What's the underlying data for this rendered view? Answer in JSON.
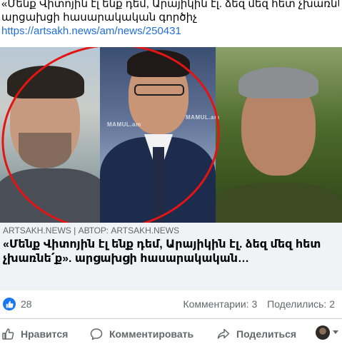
{
  "post": {
    "text_line1": "«Մենք Վիտոյին էլ ենք դեմ, Արայիկին էլ. ձեզ մեզ հետ չխառնե՛ք».",
    "text_line2": "արցախցի հասարակական գործիչ",
    "link": "https://artsakh.news/am/news/250431"
  },
  "link_card": {
    "watermark": "MAMUL.am",
    "info_icon": "info-icon",
    "domain": "ARTSAKH.NEWS | АВТОР: ARTSAKH.NEWS",
    "title": "«Մենք Վիտոյին էլ ենք դեմ, Արայիկին էլ. ձեզ մեզ հետ չխառնե՛ք». արցախցի հասարակական…"
  },
  "stats": {
    "like_icon": "like-reaction-icon",
    "like_count": "28",
    "comments": "Комментарии: 3",
    "shares": "Поделились: 2"
  },
  "actions": {
    "like_label": "Нравится",
    "comment_label": "Комментировать",
    "share_label": "Поделиться"
  },
  "colors": {
    "link": "#216fdb",
    "accent": "#1877f2",
    "card_background": "#f0f2f5",
    "circle_annotation": "#e31414"
  }
}
